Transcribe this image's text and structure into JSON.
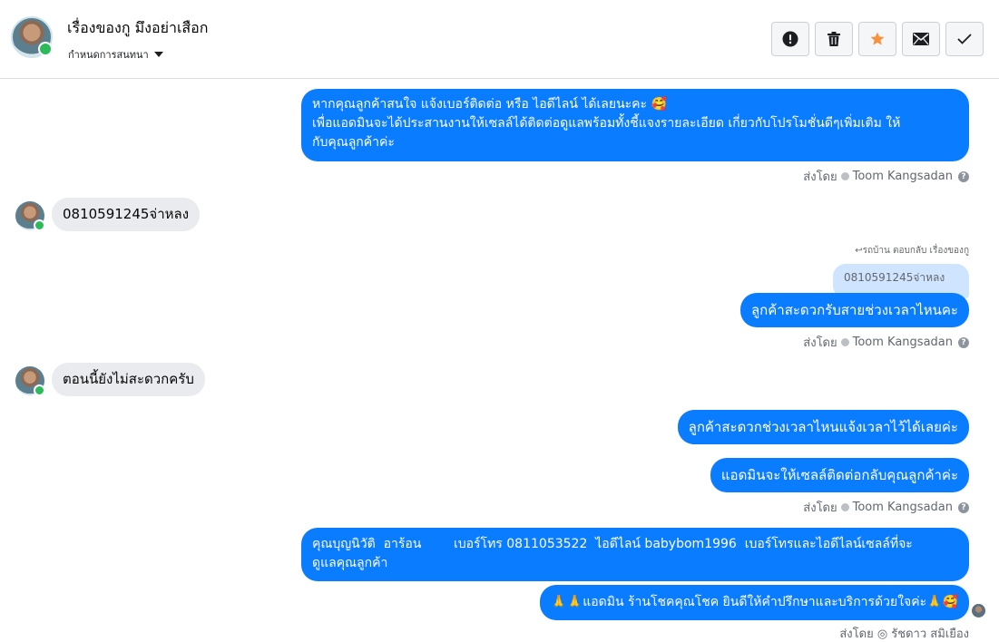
{
  "header": {
    "title": "เรื่องของกู มึงอย่าเสือก",
    "subtitle": "กำหนดการสนทนา",
    "actions": [
      {
        "name": "report-button",
        "icon": "alert-icon"
      },
      {
        "name": "delete-button",
        "icon": "trash-icon"
      },
      {
        "name": "star-button",
        "icon": "star-icon",
        "color": "#f7923b"
      },
      {
        "name": "mark-unread-button",
        "icon": "mail-icon"
      },
      {
        "name": "mark-done-button",
        "icon": "check-icon"
      }
    ]
  },
  "messages": {
    "m1": {
      "line1": "หากคุณลูกค้าสนใจ แจ้งเบอร์ติดต่อ หรือ ไอดีไลน์ ได้เลยนะคะ 🥰",
      "line2": "เพื่อแอดมินจะได้ประสานงานให้เซลล์ได้ติดต่อดูแลพร้อมทั้งชี้แจงรายละเอียด เกี่ยวกับโปรโมชั่นดีๆเพิ่มเติม ให้",
      "line3": "กับคุณลูกค้าค่ะ"
    },
    "sent_by_label": "ส่งโดย",
    "sender": "Toom Kangsadan",
    "in1": "0810591245จ่าหลง",
    "reply_note": "↩รถบ้าน ตอบกลับ เรื่องของกู",
    "quoted": "0810591245จ่าหลง",
    "m2": "ลูกค้าสะดวกรับสายช่วงเวลาไหนคะ",
    "in2": "ตอนนี้ยังไม่สะดวกครับ",
    "m3": "ลูกค้าสะดวกช่วงเวลาไหนแจ้งเวลาไว้ได้เลยค่ะ",
    "m4": "แอดมินจะให้เซลล์ติดต่อกลับคุณลูกค้าค่ะ",
    "m5": {
      "line1": "คุณบุญนิวัติ  อาร้อน        เบอร์โทร 0811053522  ไอดีไลน์ babybom1996  เบอร์โทรและไอดีไลน์เซลล์ที่จะ",
      "line2": "ดูแลคุณลูกค้า"
    },
    "m6": "🙏🙏แอดมิน ร้านโชคคุณโชค ยินดีให้คำปรึกษาและบริการด้วยใจค่ะ🙏🥰",
    "cutoff_sender": "ส่งโดย ◎ รัชดาว สมิเยือง"
  },
  "colors": {
    "outgoing": "#0a7cff",
    "incoming": "#e9ebee",
    "quoted_bg": "#cfe4ff"
  }
}
